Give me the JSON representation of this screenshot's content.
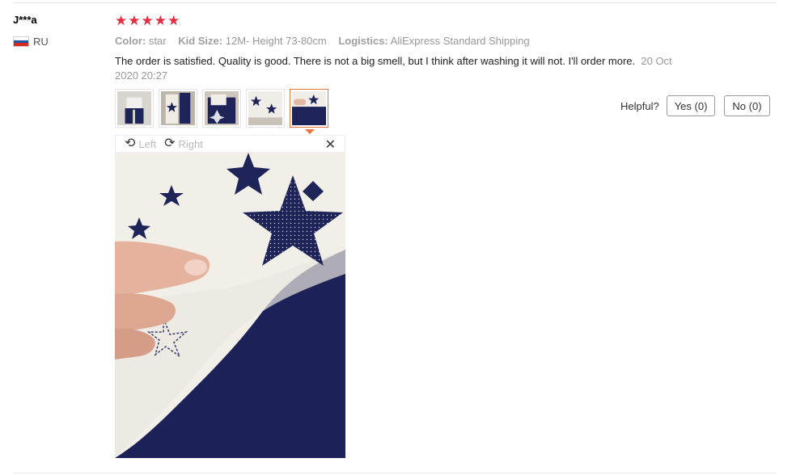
{
  "reviewer": {
    "name": "J***a",
    "country": "RU"
  },
  "rating": {
    "stars": 5,
    "glyph": "★",
    "color": "#e52e40"
  },
  "attributes": [
    {
      "key": "Color:",
      "value": "star"
    },
    {
      "key": "Kid Size:",
      "value": "12M- Height 73-80cm"
    },
    {
      "key": "Logistics:",
      "value": "AliExpress Standard Shipping"
    }
  ],
  "review": {
    "text": "The order is satisfied. Quality is good. There is not a big smell, but I think after washing it will not. I'll order more.",
    "date": "20 Oct 2020 20:27"
  },
  "helpful": {
    "label": "Helpful?",
    "yes": "Yes (0)",
    "no": "No (0)"
  },
  "viewer": {
    "rotate_left": "Left",
    "rotate_right": "Right",
    "rotate_left_icon": "⟲",
    "rotate_right_icon": "⟳",
    "close_icon": "✕"
  },
  "colors": {
    "accent": "#e8763e",
    "navy": "#1f2458",
    "border": "#e5e5e5"
  }
}
